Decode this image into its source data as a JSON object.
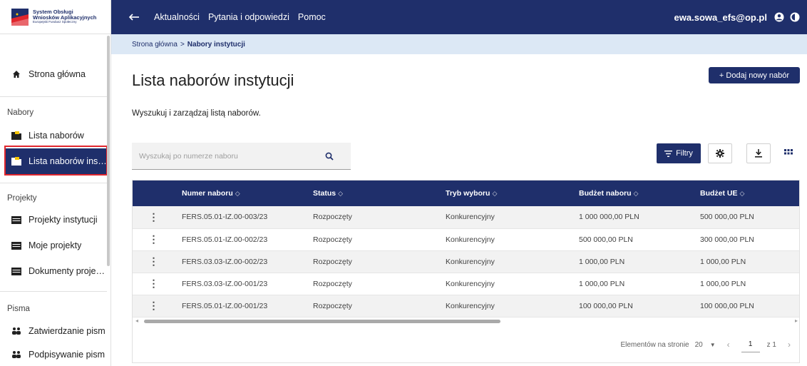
{
  "logo": {
    "line1": "System Obsługi",
    "line2": "Wniosków Aplikacyjnych",
    "line3": "Europejski Fundusz Społeczny"
  },
  "topbar": {
    "nav": [
      "Aktualności",
      "Pytania i odpowiedzi",
      "Pomoc"
    ],
    "user_email": "ewa.sowa_efs@op.pl"
  },
  "breadcrumb": {
    "home": "Strona główna",
    "separator": ">",
    "current": "Nabory instytucji"
  },
  "sidebar": {
    "home": "Strona główna",
    "section_nabory": "Nabory",
    "lista_naborow": "Lista naborów",
    "lista_naborow_instytucji": "Lista naborów insty...",
    "section_projekty": "Projekty",
    "projekty_instytucji": "Projekty instytucji",
    "moje_projekty": "Moje projekty",
    "dokumenty_projekt": "Dokumenty projekt...",
    "section_pisma": "Pisma",
    "zatwierdzanie_pism": "Zatwierdzanie pism",
    "podpisywanie_pism": "Podpisywanie pism"
  },
  "main": {
    "title": "Lista naborów instytucji",
    "add_button": "+ Dodaj nowy nabór",
    "subtitle": "Wyszukuj i zarządzaj listą naborów.",
    "search_placeholder": "Wyszukaj po numerze naboru",
    "filters_button": "Filtry"
  },
  "table": {
    "columns": [
      "Numer naboru",
      "Status",
      "Tryb wyboru",
      "Budżet naboru",
      "Budżet UE"
    ],
    "rows": [
      [
        "FERS.05.01-IZ.00-003/23",
        "Rozpoczęty",
        "Konkurencyjny",
        "1 000 000,00 PLN",
        "500 000,00 PLN"
      ],
      [
        "FERS.05.01-IZ.00-002/23",
        "Rozpoczęty",
        "Konkurencyjny",
        "500 000,00 PLN",
        "300 000,00 PLN"
      ],
      [
        "FERS.03.03-IZ.00-002/23",
        "Rozpoczęty",
        "Konkurencyjny",
        "1 000,00 PLN",
        "1 000,00 PLN"
      ],
      [
        "FERS.03.03-IZ.00-001/23",
        "Rozpoczęty",
        "Konkurencyjny",
        "1 000,00 PLN",
        "1 000,00 PLN"
      ],
      [
        "FERS.05.01-IZ.00-001/23",
        "Rozpoczęty",
        "Konkurencyjny",
        "100 000,00 PLN",
        "100 000,00 PLN"
      ]
    ]
  },
  "paginator": {
    "label": "Elementów na stronie",
    "page_size": "20",
    "page": "1",
    "of_label": "z 1"
  },
  "colors": {
    "primary": "#1f2f6b",
    "breadcrumb_bg": "#dce8f5",
    "highlight": "#e0262d",
    "row_alt": "#f2f2f2"
  }
}
